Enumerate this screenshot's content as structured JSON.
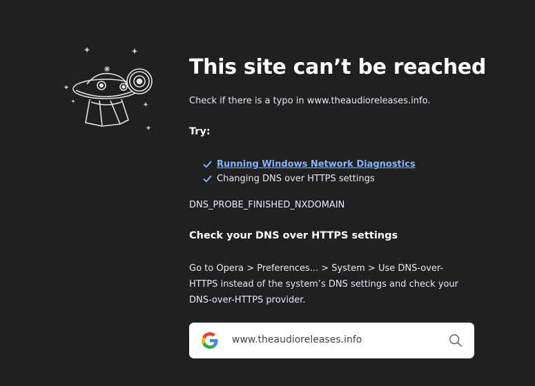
{
  "page": {
    "title": "This site can’t be reached",
    "typo_message": "Check if there is a typo in www.theaudioreleases.info.",
    "try_heading": "Try:",
    "suggestions": [
      {
        "label": "Running Windows Network Diagnostics",
        "is_link": true
      },
      {
        "label": "Changing DNS over HTTPS settings",
        "is_link": false
      }
    ],
    "error_code": "DNS_PROBE_FINISHED_NXDOMAIN",
    "dns_heading": "Check your DNS over HTTPS settings",
    "dns_body": "Go to Opera > Preferences... > System > Use DNS-over-HTTPS instead of the system’s DNS settings and check your DNS-over-HTTPS provider."
  },
  "search": {
    "value": "www.theaudioreleases.info",
    "icons": {
      "left": "google-icon",
      "right": "search-icon"
    }
  },
  "colors": {
    "background": "#1f2022",
    "link": "#8ab4f8",
    "check": "#8ab4f8",
    "text": "#e8eaed"
  }
}
